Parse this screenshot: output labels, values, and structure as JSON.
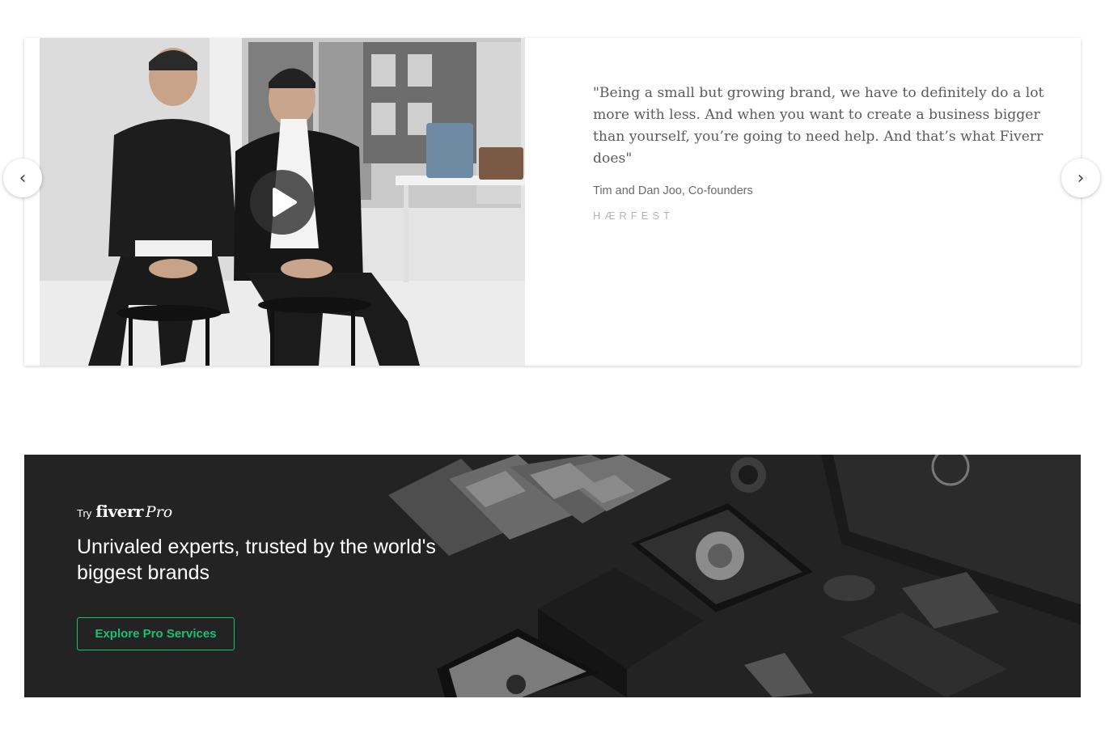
{
  "carousel": {
    "prev_arrow": "‹",
    "next_arrow": "›",
    "quote": "\"Being a small but growing brand, we have to definitely do a lot more with less. And when you want to create a business bigger than yourself, you’re going to need help. And that’s what Fiverr does\"",
    "author": "Tim and Dan Joo, Co-founders",
    "brand_logo": "HÆRFEST",
    "play_icon": "play-icon"
  },
  "pro_banner": {
    "try_label": "Try",
    "logo_word": "fiverr",
    "logo_pro": "Pro",
    "headline": "Unrivaled experts, trusted by the world's biggest brands",
    "cta_label": "Explore Pro Services",
    "cta_color": "#1dbf73",
    "background_color": "#232323"
  }
}
